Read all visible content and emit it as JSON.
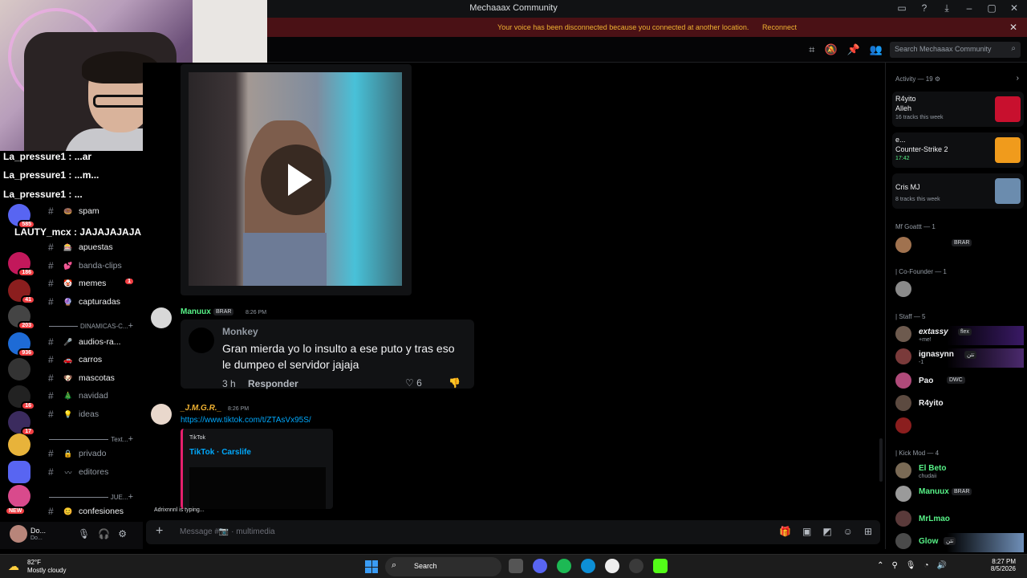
{
  "window": {
    "title": "Mechaaax Community"
  },
  "banner": {
    "text": "Your voice has been disconnected because you connected at another location.",
    "action": "Reconnect"
  },
  "header": {
    "search_placeholder": "Search Mechaaax Community"
  },
  "stream_chat": [
    {
      "text": "La_pressure1 : ...ar"
    },
    {
      "text": "La_pressure1 : ...m..."
    },
    {
      "text": "La_pressure1 : ..."
    },
    {
      "text": "LAUTY_mcx : JAJAJAJAJA"
    }
  ],
  "servers": [
    {
      "badge": "585",
      "color": "#5865f2"
    },
    {
      "badge": "186",
      "color": "#c2185b"
    },
    {
      "badge": "41",
      "color": "#8b1e1e"
    },
    {
      "badge": "203",
      "color": "#444"
    },
    {
      "badge": "936",
      "color": "#1e6bd6"
    },
    {
      "badge": "",
      "color": "#333"
    },
    {
      "badge": "16",
      "color": "#222"
    },
    {
      "badge": "17",
      "color": "#3b2b5e"
    },
    {
      "badge": "",
      "color": "#e8b33a"
    },
    {
      "badge": "",
      "color": "#5865f2"
    },
    {
      "badge": "NEW",
      "color": "#d94a8c"
    }
  ],
  "channels": [
    {
      "name": "spam",
      "emoji": "🍩",
      "muted": false
    },
    {
      "name": "apuestas",
      "emoji": "🎰",
      "muted": false
    },
    {
      "name": "banda-clips",
      "emoji": "💕",
      "muted": true
    },
    {
      "name": "memes",
      "emoji": "🤡",
      "muted": false,
      "mention": "1"
    },
    {
      "name": "capturadas",
      "emoji": "🔮",
      "muted": false
    }
  ],
  "category1": "DINAMICAS-C...",
  "channels2": [
    {
      "name": "audios-ra...",
      "emoji": "🎤",
      "muted": false
    },
    {
      "name": "carros",
      "emoji": "🚗",
      "muted": false
    },
    {
      "name": "mascotas",
      "emoji": "🐶",
      "muted": false
    },
    {
      "name": "navidad",
      "emoji": "🎄",
      "muted": true
    },
    {
      "name": "ideas",
      "emoji": "💡",
      "muted": true
    }
  ],
  "category2": "Text...",
  "channels3": [
    {
      "name": "privado",
      "emoji": "🔒",
      "muted": true
    },
    {
      "name": "editores",
      "emoji": "〰",
      "muted": true
    }
  ],
  "category3": "JUE...",
  "channels4": [
    {
      "name": "confesiones",
      "emoji": "😊",
      "muted": false
    }
  ],
  "user": {
    "name": "Do...",
    "status": "Do..."
  },
  "messages": {
    "m1": {
      "author": "Manuux",
      "tag": "BRAR",
      "time": "8:26 PM",
      "color": "#57f287"
    },
    "comment": {
      "author": "Monkey",
      "text": "Gran mierda yo lo insulto a ese puto y tras eso le dumpeo el servidor jajaja",
      "age": "3 h",
      "reply": "Responder",
      "likes": "6"
    },
    "m2": {
      "author": "_J.M.G.R._",
      "time": "8:26 PM",
      "color": "#f0b232",
      "link": "https://www.tiktok.com/t/ZTAsVx95S/"
    },
    "embed": {
      "provider": "TikTok",
      "title": "TikTok · Carslife"
    }
  },
  "typing": "Adrixnnnl is typing...",
  "composer": {
    "placeholder": "Message #📷 · multimedia"
  },
  "members": {
    "activity_header": "Activity — 19 ⚙",
    "activity": [
      {
        "name": "R4yito",
        "line2": "Alleh",
        "line3": "16 tracks this week",
        "art": "#c8102e"
      },
      {
        "name": "e...",
        "line2": "Counter-Strike 2",
        "line3": "17:42",
        "art": "#f09b1c"
      },
      {
        "name": "Cris MJ",
        "line2": "",
        "line3": "8 tracks this week",
        "art": "#6b8cae"
      }
    ],
    "groups": [
      {
        "title": "Mf Goattt — 1"
      },
      {
        "title": "| Co-Founder — 1"
      },
      {
        "title": "| Staff — 5"
      },
      {
        "title": "| Kick Mod — 4"
      }
    ],
    "goattt": [
      {
        "name": "",
        "badge": "BRAR",
        "color": "#f2f3f5",
        "av": "#a0724f"
      }
    ],
    "cofounder": [
      {
        "name": "",
        "badge": "",
        "color": "#f2f3f5",
        "av": "#8a8a8a"
      }
    ],
    "staff": [
      {
        "name": "extassy",
        "badge": "flex",
        "sub": "+me!",
        "color": "#ffffff",
        "av": "#6d5a4e"
      },
      {
        "name": "ignasynn",
        "badge": "تئن",
        "sub": "-1",
        "color": "#f2f3f5",
        "av": "#7a3a3a"
      },
      {
        "name": "Pao",
        "badge": "DWC",
        "sub": "",
        "color": "#f2f3f5",
        "av": "#b04a7a"
      },
      {
        "name": "R4yito",
        "badge": "",
        "sub": "",
        "color": "#f2f3f5",
        "av": "#5c4a40"
      },
      {
        "name": "",
        "badge": "",
        "sub": "",
        "color": "#f2f3f5",
        "av": "#8b1e1e"
      }
    ],
    "kickmod": [
      {
        "name": "El Beto",
        "badge": "",
        "sub": "chudaii",
        "color": "#57f287",
        "av": "#7a6a55"
      },
      {
        "name": "Manuux",
        "badge": "BRAR",
        "sub": "",
        "color": "#57f287",
        "av": "#9a9a9a"
      },
      {
        "name": "MrLmao",
        "badge": "",
        "sub": "",
        "color": "#57f287",
        "av": "#5a3a3a"
      },
      {
        "name": "Glow",
        "badge": "تئن",
        "sub": "",
        "color": "#57f287",
        "av": "#4a4a4a"
      }
    ]
  },
  "taskbar": {
    "temp": "82°F",
    "weather": "Mostly cloudy",
    "search": "Search",
    "time": "8:27 PM",
    "date": "8/5/2026"
  }
}
